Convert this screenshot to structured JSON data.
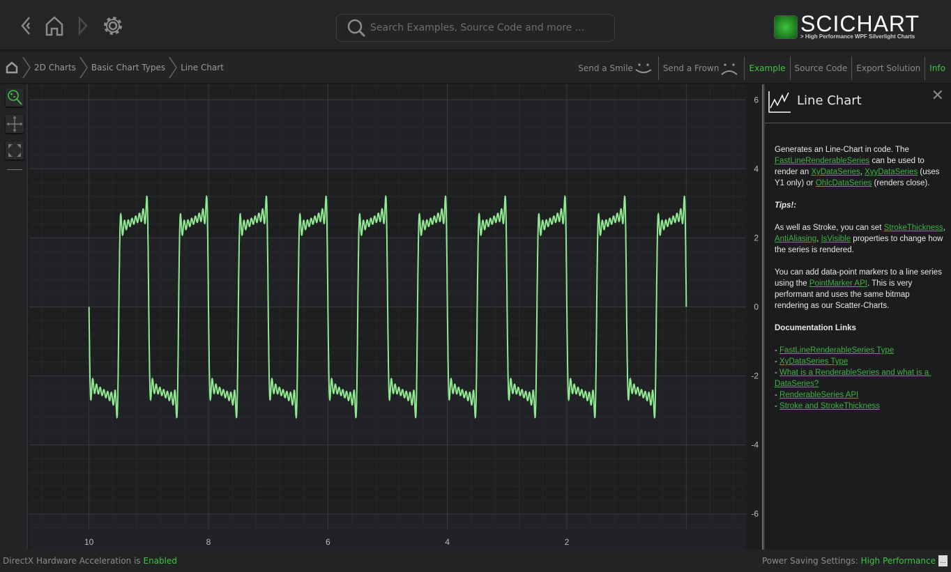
{
  "nav": {
    "back_icon": "chevron-left-icon",
    "home_icon": "home-icon",
    "forward_icon": "chevron-right-icon",
    "settings_icon": "gear-icon"
  },
  "search": {
    "placeholder": "Search Examples, Source Code and more ..."
  },
  "logo": {
    "name": "SCICHART",
    "tagline": "> High Performance WPF Silverlight Charts"
  },
  "breadcrumb": [
    "2D Charts",
    "Basic Chart Types",
    "Line Chart"
  ],
  "actions": {
    "smile": "Send a Smile",
    "frown": "Send a Frown",
    "example": "Example",
    "source": "Source Code",
    "export": "Export Solution",
    "info": "Info"
  },
  "info": {
    "title": "Line Chart",
    "paragraphs": [
      [
        {
          "t": "Generates an Line-Chart in code. The "
        },
        {
          "t": "FastLineRenderableSeries",
          "link": true
        },
        {
          "t": " can be used to render an "
        },
        {
          "t": "XyDataSeries",
          "link": true
        },
        {
          "t": ", "
        },
        {
          "t": "XyyDataSeries",
          "link": true
        },
        {
          "t": " (uses Y1 only) or "
        },
        {
          "t": "OhlcDataSeries",
          "link": true
        },
        {
          "t": " (renders close)."
        }
      ],
      [
        {
          "t": "Tips!:",
          "bold": true
        }
      ],
      [
        {
          "t": "As well as Stroke, you can set "
        },
        {
          "t": "StrokeThickness",
          "link": true
        },
        {
          "t": ", "
        },
        {
          "t": "AntiAliasing",
          "link": true
        },
        {
          "t": ", "
        },
        {
          "t": "IsVisible",
          "link": true
        },
        {
          "t": " properties to change how the series is rendered."
        }
      ],
      [
        {
          "t": "You can add data-point markers to a line series using the "
        },
        {
          "t": "PointMarker API",
          "link": true
        },
        {
          "t": ". This is very performant and uses the same bitmap rendering as our Scatter-Charts."
        }
      ],
      [
        {
          "t": "Documentation Links",
          "bold": true
        }
      ],
      [
        {
          "t": "- "
        },
        {
          "t": "FastLineRenderableSeries Type",
          "link": true
        },
        {
          "t": "\n- "
        },
        {
          "t": "XyDataSeries Type",
          "link": true
        },
        {
          "t": "\n- "
        },
        {
          "t": "What is a RenderableSeries and what is a DataSeries?",
          "link": true
        },
        {
          "t": "\n- "
        },
        {
          "t": "RenderableSeries API",
          "link": true
        },
        {
          "t": "\n- "
        },
        {
          "t": "Stroke and StrokeThickness",
          "link": true
        }
      ]
    ]
  },
  "status": {
    "left_label": "DirectX Hardware Acceleration is ",
    "left_value": "Enabled",
    "right_label": "Power Saving Settings: ",
    "right_value": "High Performance",
    "right_button": "..."
  },
  "colors": {
    "accent": "#3fc43f",
    "series": "#90e890",
    "background": "#1c1d1f"
  },
  "chart_data": {
    "type": "line",
    "title": "",
    "xlabel": "",
    "ylabel": "",
    "xlim": [
      11,
      -1
    ],
    "x_reversed": true,
    "ylim": [
      -6.45,
      6.45
    ],
    "x_ticks": [
      10,
      8,
      6,
      4,
      2
    ],
    "y_ticks": [
      6,
      4,
      2,
      0,
      -2,
      -4,
      -6
    ],
    "y_axis_position": "right",
    "grid": true,
    "series": [
      {
        "shape": "square wave with ripple",
        "x_range": [
          0,
          10
        ],
        "period": 1,
        "low_level": -2.5,
        "high_level": 2.5,
        "peak": 3.2,
        "trough": -3.2,
        "first_y": 0.3,
        "last_y": 0.6,
        "color": "#90e890"
      }
    ]
  }
}
